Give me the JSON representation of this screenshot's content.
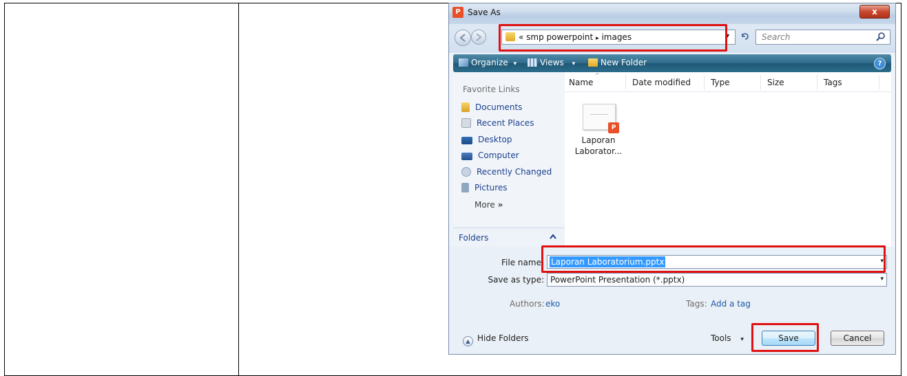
{
  "dialog": {
    "title": "Save As",
    "close_label": "x",
    "path": {
      "prefix": "«",
      "segment_1": "smp powerpoint",
      "separator": "▸",
      "segment_2": "images",
      "dropdown": "▾"
    },
    "search_placeholder": "Search",
    "toolbar": {
      "organize": "Organize",
      "views": "Views",
      "new_folder": "New Folder",
      "dropdown": "▾"
    },
    "favorites": {
      "heading": "Favorite Links",
      "items": [
        "Documents",
        "Recent Places",
        "Desktop",
        "Computer",
        "Recently Changed",
        "Pictures"
      ],
      "more": "More",
      "more_glyph": "»"
    },
    "folders_label": "Folders",
    "columns": [
      "Name",
      "Date modified",
      "Type",
      "Size",
      "Tags"
    ],
    "file": {
      "line_1": "Laporan",
      "line_2": "Laborator..."
    },
    "form": {
      "file_name_label": "File name:",
      "file_name_value": "Laporan Laboratorium.pptx",
      "save_type_label": "Save as type:",
      "save_type_value": "PowerPoint Presentation (*.pptx)",
      "authors_label": "Authors:",
      "authors_value": "eko",
      "tags_label": "Tags:",
      "tags_value": "Add a tag"
    },
    "footer": {
      "hide_folders": "Hide Folders",
      "tools": "Tools",
      "save": "Save",
      "cancel": "Cancel"
    }
  },
  "colors": {
    "highlight_box": "#e01010",
    "toolbar": "#2f6a8a",
    "link": "#1c3f8c",
    "selection": "#3399ff"
  }
}
